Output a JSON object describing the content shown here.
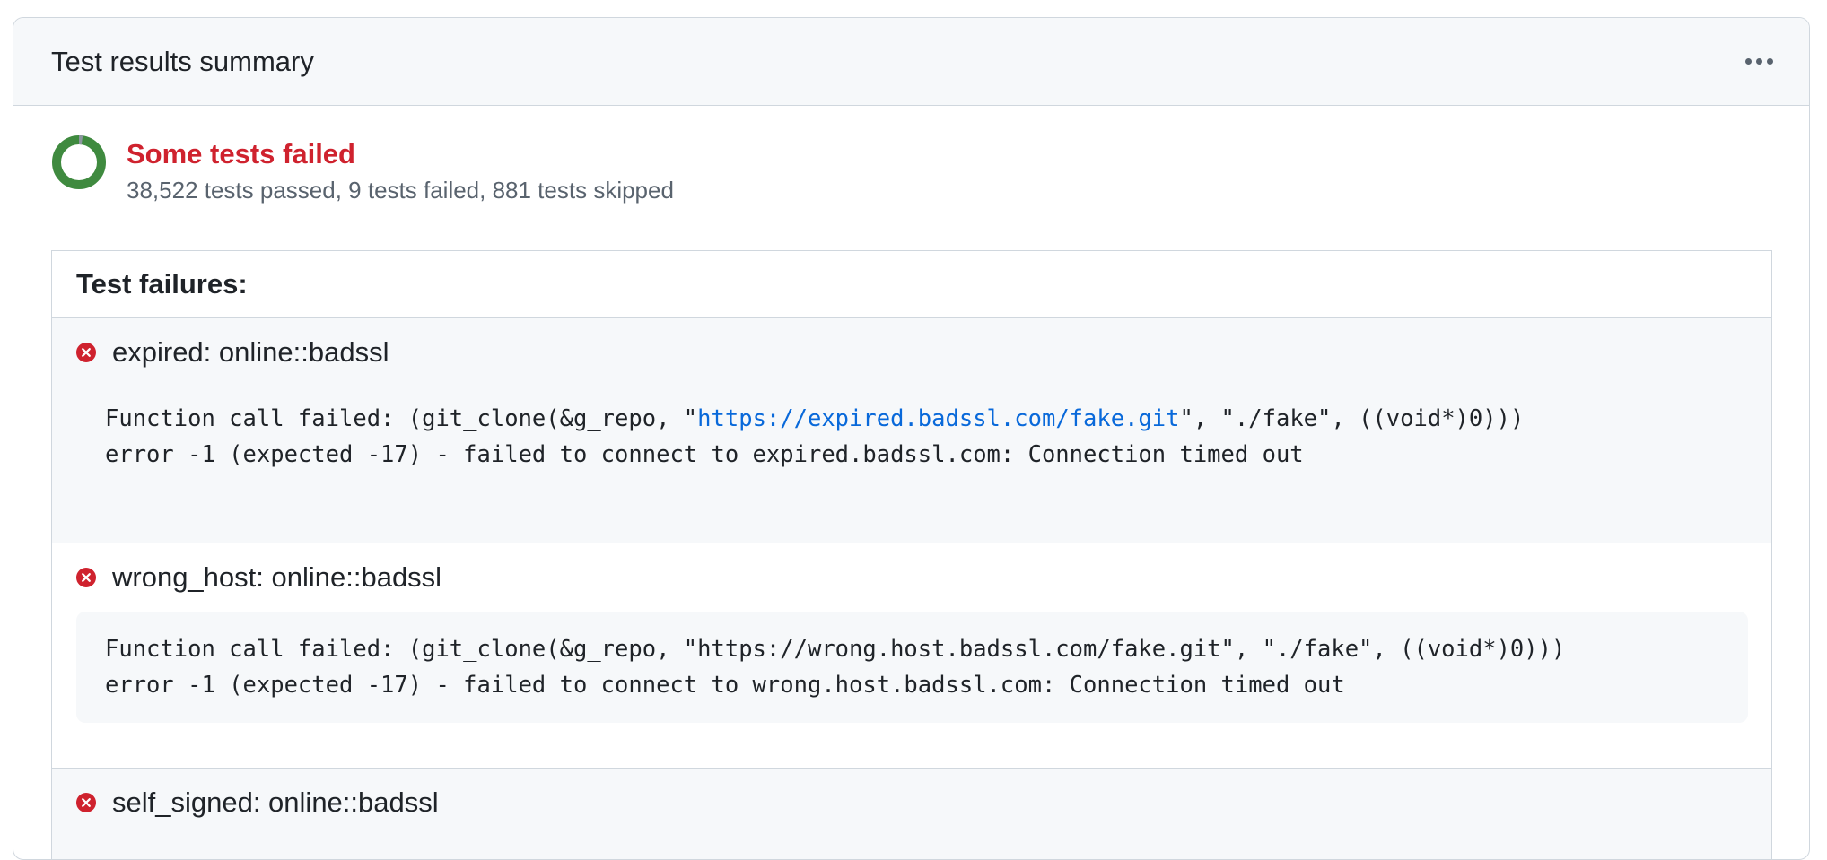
{
  "card": {
    "title": "Test results summary",
    "menu_icon": "kebab-horizontal-icon"
  },
  "summary": {
    "status": "Some tests failed",
    "detail": "38,522 tests passed, 9 tests failed, 881 tests skipped",
    "status_color": "#cf222e",
    "counts": {
      "passed": 38522,
      "failed": 9,
      "skipped": 881
    },
    "colors": {
      "passed": "#3f8a3f",
      "failed": "#cf222e",
      "skipped": "#8c959f"
    }
  },
  "failures": {
    "heading": "Test failures:",
    "items": [
      {
        "name": "expired: online::badssl",
        "line1_pre": "Function call failed: (git_clone(&g_repo, \"",
        "line1_link": "https://expired.badssl.com/fake.git",
        "line1_post": "\", \"./fake\", ((void*)0)))",
        "line2": "error -1 (expected -17) - failed to connect to expired.badssl.com: Connection timed out"
      },
      {
        "name": "wrong_host: online::badssl",
        "line1": "Function call failed: (git_clone(&g_repo, \"https://wrong.host.badssl.com/fake.git\", \"./fake\", ((void*)0)))",
        "line2": "error -1 (expected -17) - failed to connect to wrong.host.badssl.com: Connection timed out"
      },
      {
        "name": "self_signed: online::badssl"
      }
    ]
  },
  "icons": {
    "failure": "x-circle-fill-icon",
    "status": "donut-chart-icon"
  },
  "colors": {
    "error": "#cf222e",
    "link": "#0969da",
    "border": "#d0d7de",
    "header_bg": "#f6f8fa"
  }
}
